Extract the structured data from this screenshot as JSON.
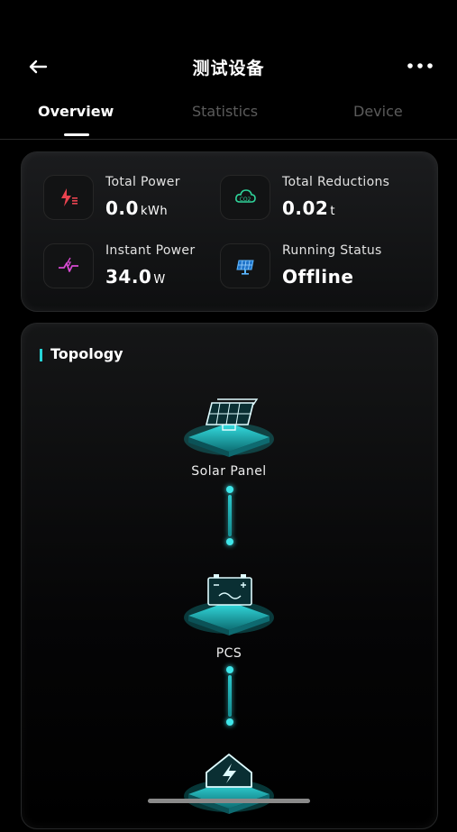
{
  "header": {
    "title": "测试设备",
    "back_icon": "arrow-left-icon",
    "more_icon": "more-horizontal-icon"
  },
  "tabs": [
    {
      "label": "Overview",
      "active": true
    },
    {
      "label": "Statistics",
      "active": false
    },
    {
      "label": "Device",
      "active": false
    }
  ],
  "stats": {
    "total_power": {
      "label": "Total Power",
      "value": "0.0",
      "unit": "kWh",
      "icon": "power-icon",
      "color": "#e8434f"
    },
    "total_reductions": {
      "label": "Total Reductions",
      "value": "0.02",
      "unit": "t",
      "icon": "co2-cloud-icon",
      "color": "#2fd39a"
    },
    "instant_power": {
      "label": "Instant Power",
      "value": "34.0",
      "unit": "W",
      "icon": "pulse-icon",
      "color": "#d64ad1"
    },
    "running_status": {
      "label": "Running Status",
      "value": "Offline",
      "icon": "solar-panel-icon",
      "color": "#3aa2ff"
    }
  },
  "topology": {
    "title": "Topology",
    "nodes": [
      {
        "label": "Solar Panel",
        "icon": "solar-panel-icon"
      },
      {
        "label": "PCS",
        "icon": "battery-icon"
      },
      {
        "label": "",
        "icon": "home-energy-icon"
      }
    ]
  },
  "colors": {
    "accent": "#27d3d6",
    "background": "#000000"
  }
}
